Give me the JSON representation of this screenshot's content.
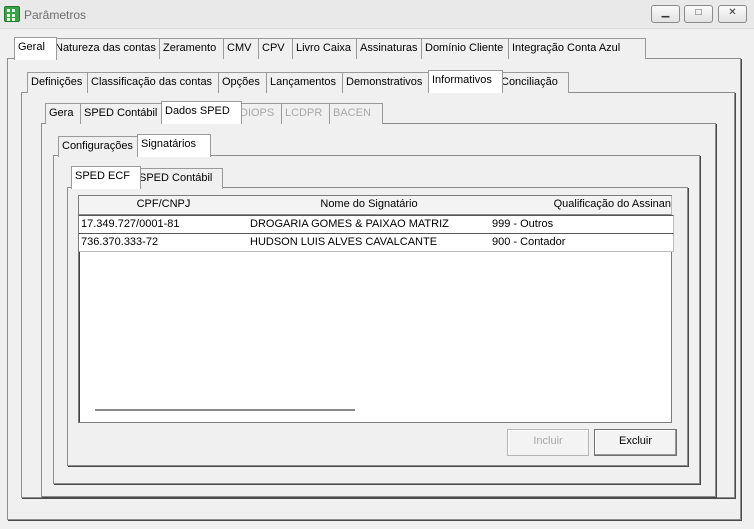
{
  "window": {
    "title": "Parâmetros"
  },
  "tabs_level1": [
    "Geral",
    "Natureza das contas",
    "Zeramento",
    "CMV",
    "CPV",
    "Livro Caixa",
    "Assinaturas",
    "Domínio Cliente",
    "Integração Conta Azul"
  ],
  "tabs_level2": [
    "Definições",
    "Classificação das contas",
    "Opções",
    "Lançamentos",
    "Demonstrativos",
    "Informativos",
    "Conciliação"
  ],
  "tabs_level3": [
    "Gera",
    "SPED Contábil",
    "Dados SPED",
    "DIOPS",
    "LCDPR",
    "BACEN"
  ],
  "tabs_level4": [
    "Configurações",
    "Signatários"
  ],
  "tabs_level5": [
    "SPED ECF",
    "SPED Contábil"
  ],
  "grid": {
    "columns": [
      "CPF/CNPJ",
      "Nome do Signatário",
      "Qualificação do Assinan"
    ],
    "rows": [
      [
        "17.349.727/0001-81",
        "DROGARIA GOMES & PAIXAO MATRIZ",
        "999 - Outros"
      ],
      [
        "736.370.333-72",
        "HUDSON LUIS ALVES CAVALCANTE",
        "900 - Contador"
      ]
    ]
  },
  "buttons": {
    "incluir": "Incluir",
    "excluir": "Excluir"
  }
}
